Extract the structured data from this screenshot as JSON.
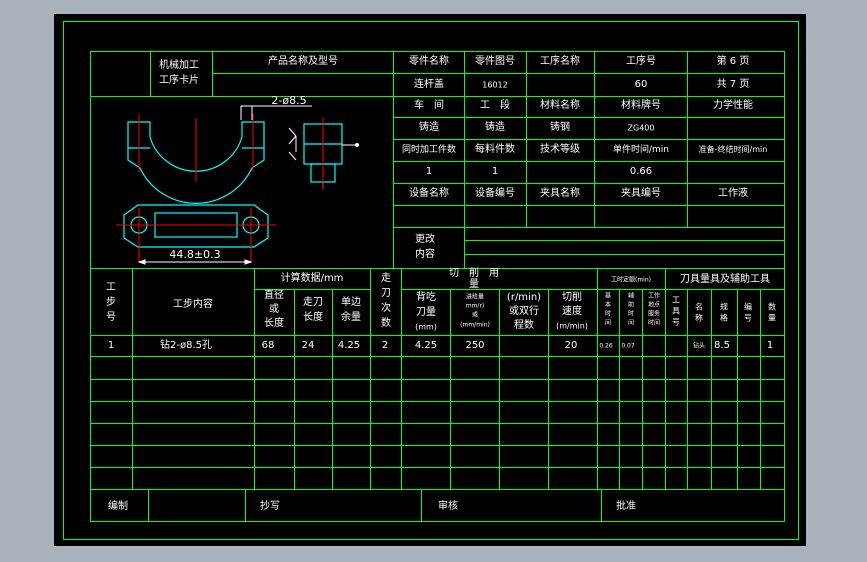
{
  "header": {
    "card_title_1": "机械加工",
    "card_title_2": "工序卡片",
    "product_name_label": "产品名称及型号",
    "part_name_label": "零件名称",
    "part_number_label": "零件图号",
    "process_name_label": "工序名称",
    "process_no_label": "工序号",
    "page_label": "第 6 页",
    "part_name": "连杆盖",
    "part_number": "16012",
    "process_no": "60",
    "total_pages": "共 7 页",
    "workshop_label": "车　间",
    "section_label": "工　段",
    "material_name_label": "材料名称",
    "material_grade_label": "材料牌号",
    "mechanical_label": "力学性能",
    "workshop": "铸造",
    "section": "铸造",
    "material_name": "铸钢",
    "material_grade": "ZG400",
    "simul_parts_label": "同时加工件数",
    "blank_parts_label": "每料件数",
    "tech_level_label": "技术等级",
    "unit_time_label": "单件时间/min",
    "prep_time_label": "准备-终结时间/min",
    "simul_parts": "1",
    "blank_parts": "1",
    "unit_time": "0.66",
    "equip_name_label": "设备名称",
    "equip_no_label": "设备编号",
    "fixture_name_label": "夹具名称",
    "fixture_no_label": "夹具编号",
    "coolant_label": "工作液",
    "change_label_1": "更改",
    "change_label_2": "内容"
  },
  "drawing": {
    "hole_dim": "2-ø8.5",
    "center_dim": "44.8±0.3"
  },
  "table_head": {
    "step_no": [
      "工",
      "步",
      "号"
    ],
    "step_content": "工步内容",
    "calc_data": "计算数据/mm",
    "diameter": [
      "直径",
      "或",
      "长度"
    ],
    "feed_length": [
      "走刀",
      "长度"
    ],
    "allowance": [
      "单边",
      "余量"
    ],
    "passes": [
      "走",
      "刀",
      "次",
      "数"
    ],
    "cutting": "切　削　用",
    "cutting2": "量",
    "depth": [
      "背吃",
      "刀量",
      "(mm)"
    ],
    "feed": [
      "进给量",
      "mm/r)",
      "或",
      "(mm/min)"
    ],
    "speed_rev": [
      "(r/min)",
      "或双行",
      "程数"
    ],
    "cut_speed": [
      "切削",
      "速度",
      "(m/min)"
    ],
    "time_quota": "工时定额(min)",
    "basic_time": [
      "基",
      "本",
      "时",
      "间"
    ],
    "aux_time": [
      "辅",
      "助",
      "时",
      "间"
    ],
    "work_place": [
      "工作",
      "地点",
      "服务",
      "时间"
    ],
    "tools": "刀具量具及辅助工具",
    "tool_type": [
      "工",
      "具",
      "号"
    ],
    "tool_name": [
      "名",
      "称"
    ],
    "tool_spec": [
      "规",
      "格"
    ],
    "tool_code": [
      "编",
      "号"
    ],
    "tool_qty": [
      "数",
      "量"
    ]
  },
  "rows": [
    {
      "step": "1",
      "content": "钻2-ø8.5孔",
      "diameter": "68",
      "feed_length": "24",
      "allowance": "4.25",
      "passes": "2",
      "depth": "4.25",
      "feed": "250",
      "speed_rev": "",
      "cut_speed": "20",
      "basic_time": "0.26",
      "aux_time": "0.07",
      "tool_name": "钻头",
      "tool_spec": "8.5",
      "tool_qty": "1"
    }
  ],
  "footer": {
    "editor": "编制",
    "copy": "抄写",
    "check": "审核",
    "approve": "批准"
  },
  "colors": {
    "line": "#00ff00",
    "red": "#ff0000",
    "cyan": "#00ffff",
    "background": "#000000"
  }
}
